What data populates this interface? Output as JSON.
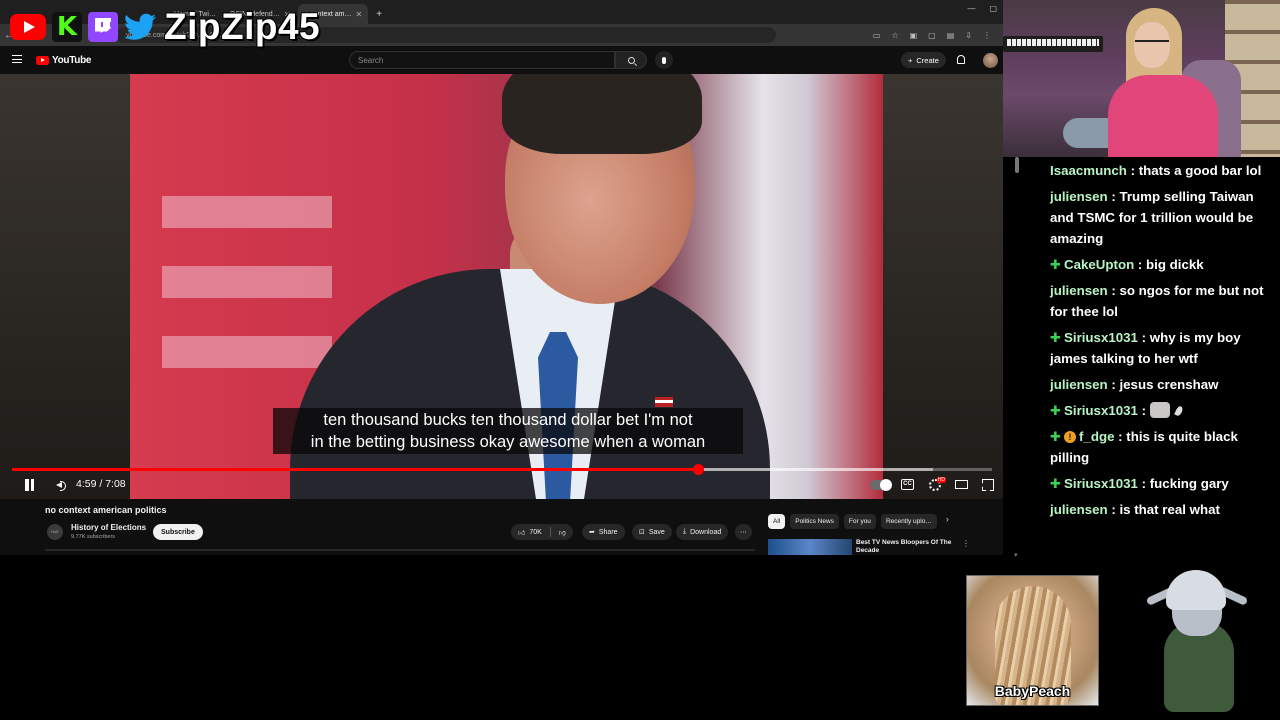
{
  "browser": {
    "tabs": [
      "Home / Twi…",
      "OSINTdefend…",
      "a context am…"
    ],
    "url_text": "youtube.com/watch?v=…14FC"
  },
  "overlay": {
    "handle": "ZipZip45",
    "icons": [
      "youtube-logo",
      "kick-logo",
      "twitch-logo",
      "twitter-bird"
    ]
  },
  "youtube": {
    "logo_text": "YouTube",
    "search_placeholder": "Search",
    "create_label": "Create",
    "video": {
      "subtitle_line1": "ten thousand bucks ten thousand dollar bet I'm not",
      "subtitle_line2": "in the betting business okay awesome when a woman",
      "current_time": "4:59",
      "duration": "7:08",
      "timecode": "4:59 / 7:08",
      "progress_fraction": 0.7,
      "buffered_fraction": 0.94,
      "cc_label": "CC"
    },
    "below": {
      "title": "no context american politics",
      "channel_name": "History of Elections",
      "channel_subs": "9.77K subscribers",
      "subscribe_label": "Subscribe",
      "likes": "70K",
      "share_label": "Share",
      "save_label": "Save",
      "download_label": "Download"
    },
    "chips": [
      "All",
      "Politics News",
      "For you",
      "Recently uplo…"
    ],
    "recommendation": {
      "title": "Best TV News Bloopers Of The Decade"
    }
  },
  "chat": {
    "messages": [
      {
        "badges": "",
        "user": "Isaacmunch",
        "text": " : thats a good bar lol"
      },
      {
        "badges": "",
        "user": "juliensen",
        "text": " : Trump selling Taiwan and TSMC for 1 trillion would be amazing"
      },
      {
        "badges": "plus",
        "user": "CakeUpton",
        "text": " : big dickk"
      },
      {
        "badges": "",
        "user": "juliensen",
        "text": " : so ngos for me but not for thee lol"
      },
      {
        "badges": "plus",
        "user": "Siriusx1031",
        "text": " : why is my boy james talking to her wtf"
      },
      {
        "badges": "",
        "user": "juliensen",
        "text": " : jesus crenshaw"
      },
      {
        "badges": "plus",
        "user": "Siriusx1031",
        "text": " : "
      },
      {
        "badges": "plus-coin",
        "user": "f_dge",
        "text": " : this is quite black pilling"
      },
      {
        "badges": "plus",
        "user": "Siriusx1031",
        "text": " : fucking gary"
      },
      {
        "badges": "",
        "user": "juliensen",
        "text": " : is that real what"
      }
    ]
  },
  "cards": {
    "peach_name": "BabyPeach"
  },
  "colors": {
    "youtube_red": "#ff0000",
    "chat_username": "#b9f3c4",
    "badge_green": "#3ecf57",
    "twitch_purple": "#9146ff",
    "kick_green": "#53fc18"
  }
}
